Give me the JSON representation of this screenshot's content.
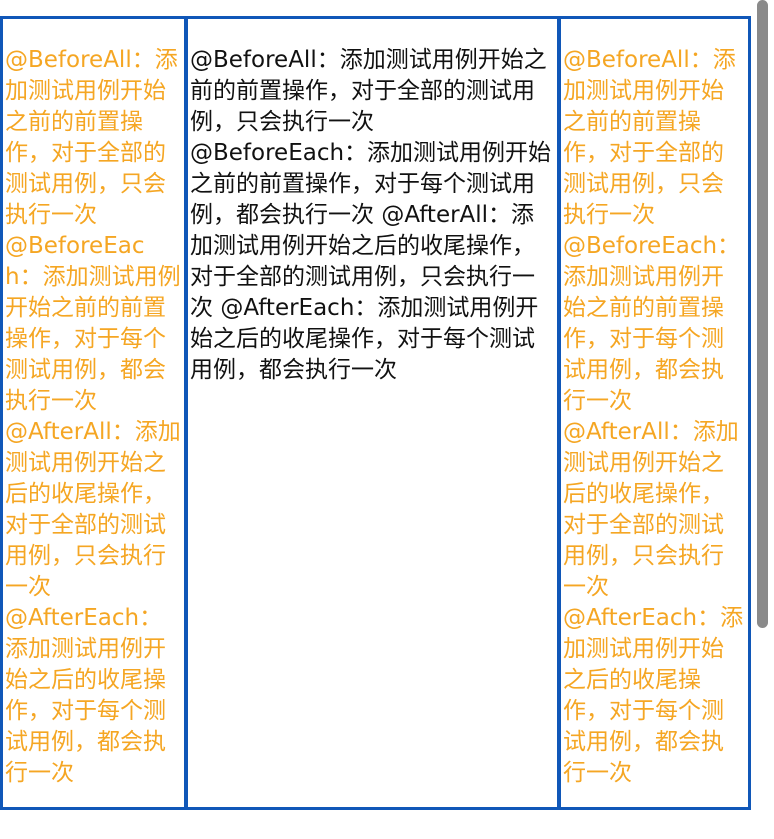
{
  "annotations": {
    "before_all": "@BeforeAll：添加测试用例开始之前的前置操作，对于全部的测试用例，只会执行一次",
    "before_each": "@BeforeEach：添加测试用例开始之前的前置操作，对于每个测试用例，都会执行一次",
    "after_all": "@AfterAll：添加测试用例开始之后的收尾操作，对于全部的测试用例，只会执行一次",
    "after_each": "@AfterEach：添加测试用例开始之后的收尾操作，对于每个测试用例，都会执行一次"
  },
  "colors": {
    "border": "#1057b8",
    "side_text": "#f5a623",
    "middle_text": "#111111",
    "scrollbar": "#8a8a8a"
  }
}
